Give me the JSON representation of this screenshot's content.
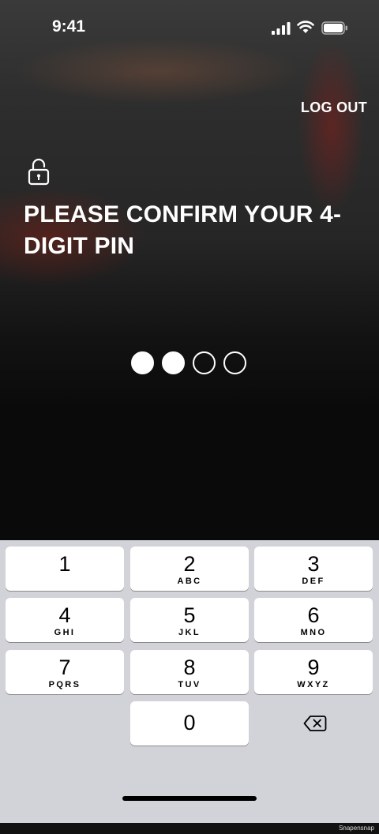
{
  "status_bar": {
    "time": "9:41",
    "icons": [
      "signal-icon",
      "wifi-icon",
      "battery-icon"
    ]
  },
  "header": {
    "logout_label": "LOG OUT"
  },
  "main": {
    "lock_icon": "lock-icon",
    "title": "PLEASE CONFIRM YOUR 4-DIGIT PIN",
    "pin": {
      "length": 4,
      "entered": 2
    }
  },
  "keypad": {
    "keys": [
      {
        "digit": "1",
        "letters": ""
      },
      {
        "digit": "2",
        "letters": "ABC"
      },
      {
        "digit": "3",
        "letters": "DEF"
      },
      {
        "digit": "4",
        "letters": "GHI"
      },
      {
        "digit": "5",
        "letters": "JKL"
      },
      {
        "digit": "6",
        "letters": "MNO"
      },
      {
        "digit": "7",
        "letters": "PQRS"
      },
      {
        "digit": "8",
        "letters": "TUV"
      },
      {
        "digit": "9",
        "letters": "WXYZ"
      },
      {
        "digit": "0",
        "letters": ""
      }
    ],
    "delete_icon": "backspace-icon"
  },
  "footer": {
    "credit": "Snapensnap"
  },
  "colors": {
    "keypad_background": "#d1d3d9",
    "key_background": "#ffffff",
    "text_light": "#ffffff"
  }
}
